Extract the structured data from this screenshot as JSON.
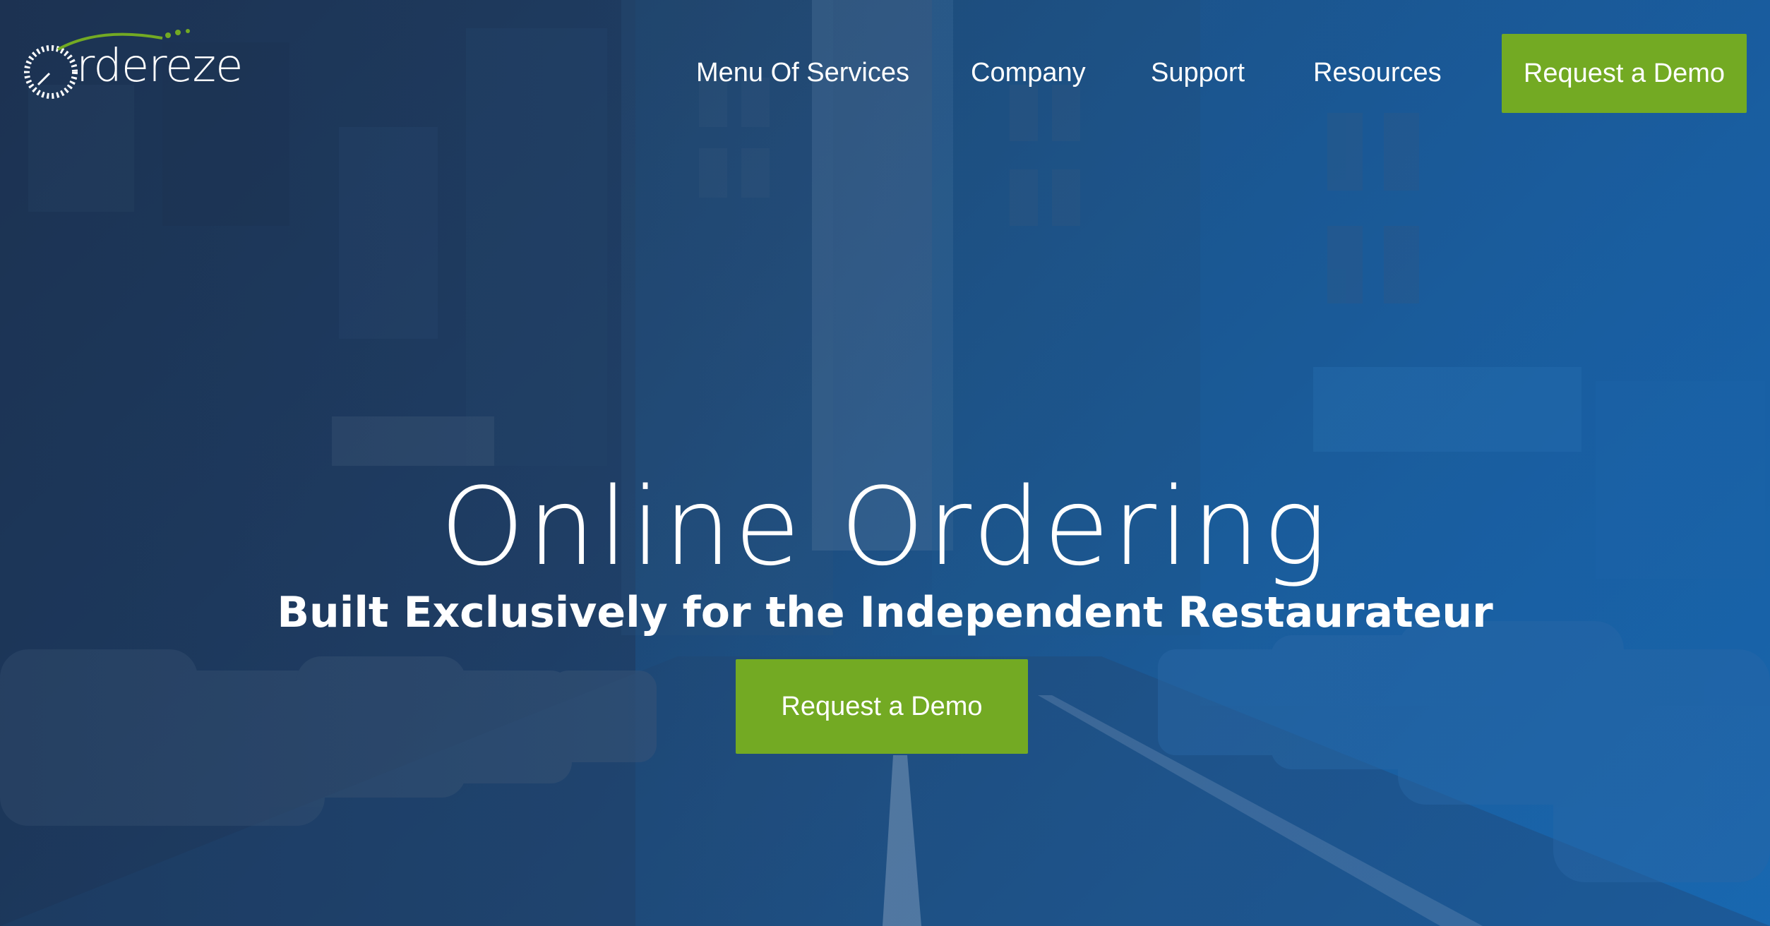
{
  "brand": {
    "logo_text": "rdereze",
    "accent_green": "#73aa23",
    "hero_blue": "#1f4a78"
  },
  "nav": {
    "items": [
      {
        "label": "Menu Of Services"
      },
      {
        "label": "Company"
      },
      {
        "label": "Support"
      },
      {
        "label": "Resources"
      }
    ],
    "cta_label": "Request a Demo"
  },
  "hero": {
    "title": "Online Ordering",
    "subtitle": "Built Exclusively for the Independent Restaurateur",
    "cta_label": "Request a Demo",
    "background": "city-street-photo"
  }
}
